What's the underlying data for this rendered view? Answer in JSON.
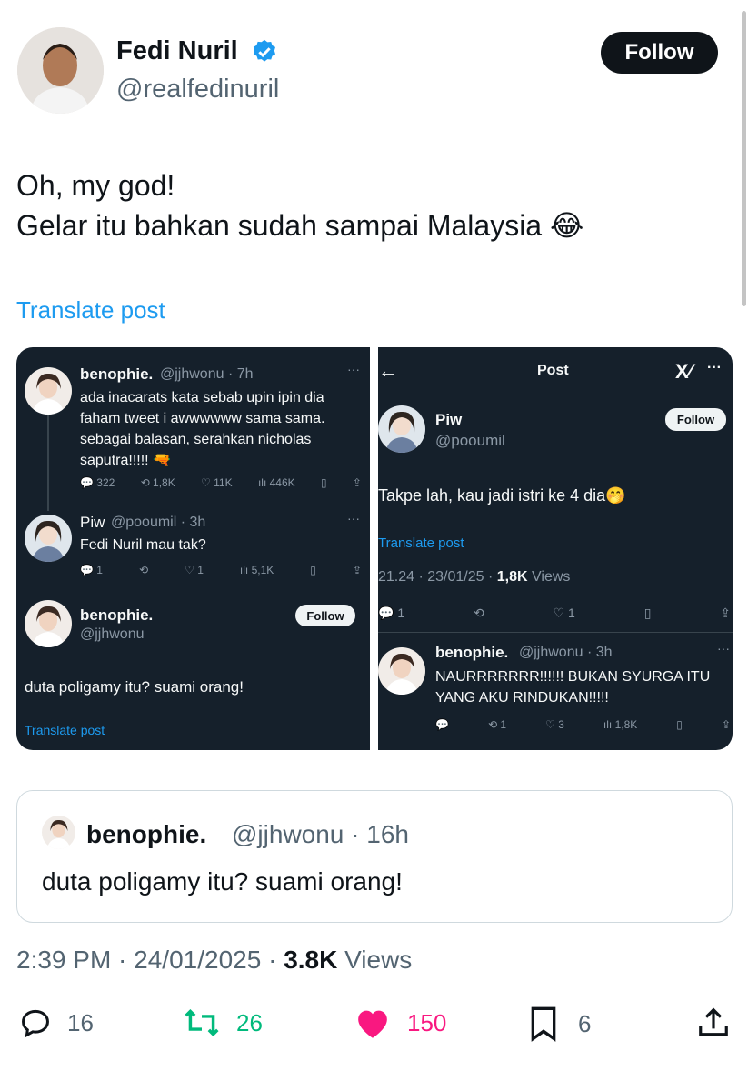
{
  "author": {
    "name": "Fedi Nuril",
    "handle": "@realfedinuril",
    "verified": true,
    "follow_label": "Follow"
  },
  "post": {
    "text_line1": "Oh, my god!",
    "text_line2": "Gelar itu bahkan sudah sampai Malaysia 😂",
    "translate_label": "Translate post"
  },
  "media": {
    "left": {
      "tweet1": {
        "name": "benophie.",
        "handle_time": "@jjhwonu · 7h",
        "more": "···",
        "text": "ada inacarats kata sebab upin ipin dia faham tweet i awwwwww sama sama. sebagai balasan, serahkan nicholas saputra!!!!! 🔫",
        "replies": "322",
        "reposts": "1,8K",
        "likes": "11K",
        "views": "446K"
      },
      "tweet2": {
        "name": "Piw",
        "handle_time": "@pooumil · 3h",
        "more": "···",
        "text": "Fedi Nuril mau tak?",
        "replies": "1",
        "likes": "1",
        "views": "5,1K"
      },
      "main": {
        "name": "benophie.",
        "handle": "@jjhwonu",
        "follow_label": "Follow",
        "text": "duta poligamy itu? suami orang!",
        "translate_label": "Translate post"
      }
    },
    "right": {
      "header_title": "Post",
      "header_more": "···",
      "main": {
        "name": "Piw",
        "handle": "@pooumil",
        "follow_label": "Follow",
        "text": "Takpe lah, kau jadi istri ke 4 dia🤭",
        "translate_label": "Translate post",
        "time": "21.24 · 23/01/25 · ",
        "views_count": "1,8K",
        "views_label": " Views",
        "replies": "1",
        "likes": "1"
      },
      "reply": {
        "name": "benophie.",
        "handle_time": "@jjhwonu · 3h",
        "more": "···",
        "text": "NAURRRRRRR!!!!!! BUKAN SYURGA ITU YANG AKU RINDUKAN!!!!!",
        "reposts": "1",
        "likes": "3",
        "views": "1,8K"
      }
    }
  },
  "quote": {
    "name": "benophie.",
    "handle_time": "@jjhwonu · 16h",
    "text": "duta poligamy itu? suami orang!"
  },
  "meta": {
    "time": "2:39 PM · 24/01/2025 · ",
    "views_count": "3.8K",
    "views_label": " Views"
  },
  "actions": {
    "replies": "16",
    "reposts": "26",
    "likes": "150",
    "bookmarks": "6"
  },
  "icons": {
    "verified": "verified-badge-icon",
    "reply": "reply-icon",
    "repost": "repost-icon",
    "like": "heart-icon",
    "bookmark": "bookmark-icon",
    "share": "share-icon",
    "grok": "grok-icon"
  },
  "colors": {
    "accent_blue": "#1d9bf0",
    "repost_green": "#00ba7c",
    "like_pink": "#f91880",
    "dark_bg": "#15202b"
  }
}
